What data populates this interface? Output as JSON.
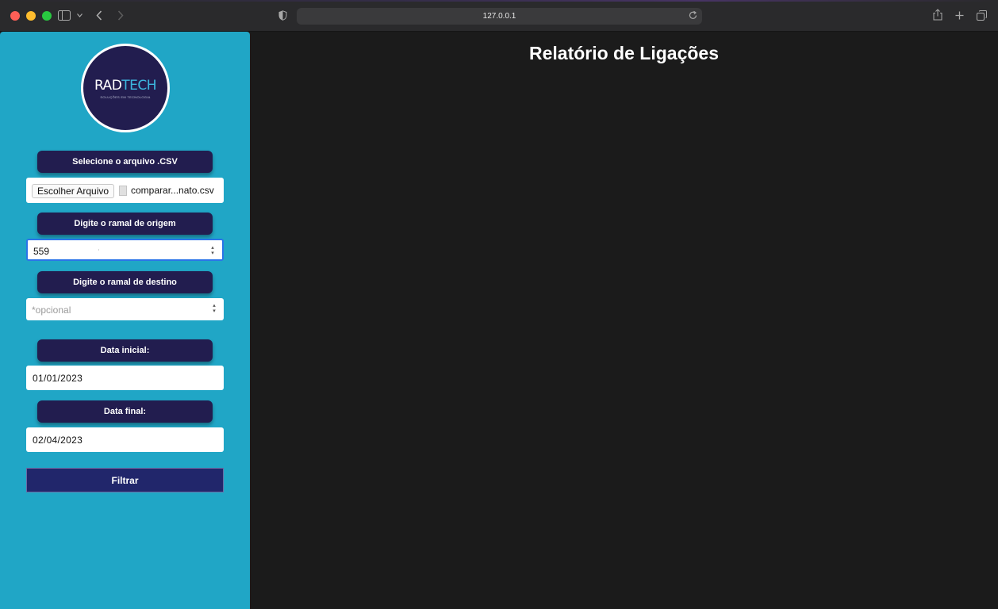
{
  "browser": {
    "url": "127.0.0.1",
    "icons": {
      "sidebar": "sidebar-toggle-icon",
      "back": "chevron-left-icon",
      "forward": "chevron-right-icon",
      "shield": "shield-icon",
      "reload": "reload-icon",
      "share": "share-icon",
      "new_tab": "plus-icon",
      "tabs": "tabs-overview-icon"
    }
  },
  "sidebar": {
    "logo": {
      "text_main_a": "RAD",
      "text_main_b": "TECH",
      "tagline": "SOLUÇÕES EM TECNOLOGIA"
    },
    "file_label": "Selecione o arquivo .CSV",
    "file_button": "Escolher Arquivo",
    "file_name": "comparar...nato.csv",
    "origin_label": "Digite o ramal de origem",
    "origin_value": "559",
    "dest_label": "Digite o ramal de destino",
    "dest_placeholder": "*opcional",
    "start_label": "Data inicial:",
    "start_value": "01/01/2023",
    "end_label": "Data final:",
    "end_value": "02/04/2023",
    "submit_label": "Filtrar"
  },
  "main": {
    "title": "Relatório de Ligações"
  },
  "colors": {
    "sidebar_bg": "#20a6c6",
    "label_bg": "#221d4f",
    "submit_bg": "#21266b",
    "focus": "#2a74e8",
    "page_bg": "#1b1b1b"
  }
}
